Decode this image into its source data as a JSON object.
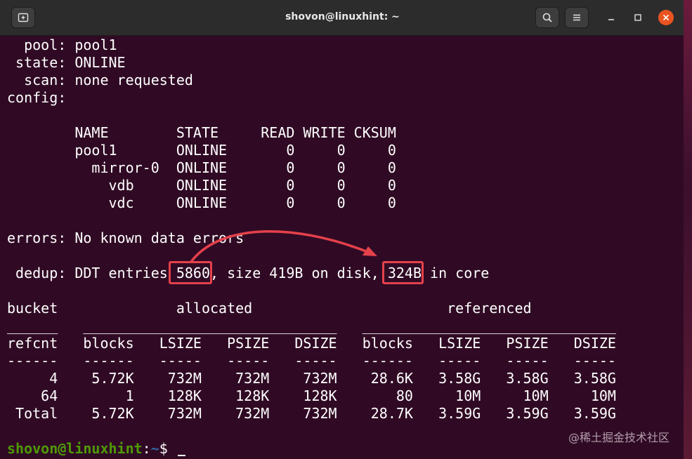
{
  "window": {
    "title": "shovon@linuxhint: ~"
  },
  "terminal": {
    "lines": [
      "  pool: pool1",
      " state: ONLINE",
      "  scan: none requested",
      "config:",
      "",
      "        NAME        STATE     READ WRITE CKSUM",
      "        pool1       ONLINE       0     0     0",
      "          mirror-0  ONLINE       0     0     0",
      "            vdb     ONLINE       0     0     0",
      "            vdc     ONLINE       0     0     0",
      "",
      "errors: No known data errors",
      "",
      " dedup: DDT entries 5860, size 419B on disk, 324B in core",
      "",
      "bucket              allocated                       referenced",
      "______   ______________________________   ______________________________",
      "refcnt   blocks   LSIZE   PSIZE   DSIZE   blocks   LSIZE   PSIZE   DSIZE",
      "------   ------   -----   -----   -----   ------   -----   -----   -----",
      "     4    5.72K    732M    732M    732M    28.6K   3.58G   3.58G   3.58G",
      "    64        1    128K    128K    128K       80     10M     10M     10M",
      " Total    5.72K    732M    732M    732M    28.7K   3.59G   3.59G   3.59G",
      ""
    ],
    "prompt": {
      "user": "shovon@linuxhint",
      "sep": ":",
      "path": "~",
      "symbol": "$ "
    }
  },
  "highlights": {
    "ddt_entries": "5860",
    "in_core_size": "324B"
  },
  "watermark": "@稀土掘金技术社区",
  "colors": {
    "background": "#300a24",
    "highlight": "#e5414b",
    "prompt_user": "#4e9a06",
    "prompt_path": "#3465a4"
  },
  "icons": {
    "new_tab": "new-tab-icon",
    "search": "search-icon",
    "menu": "hamburger-menu-icon",
    "minimize": "minimize-icon",
    "maximize": "maximize-icon",
    "close": "close-icon"
  }
}
